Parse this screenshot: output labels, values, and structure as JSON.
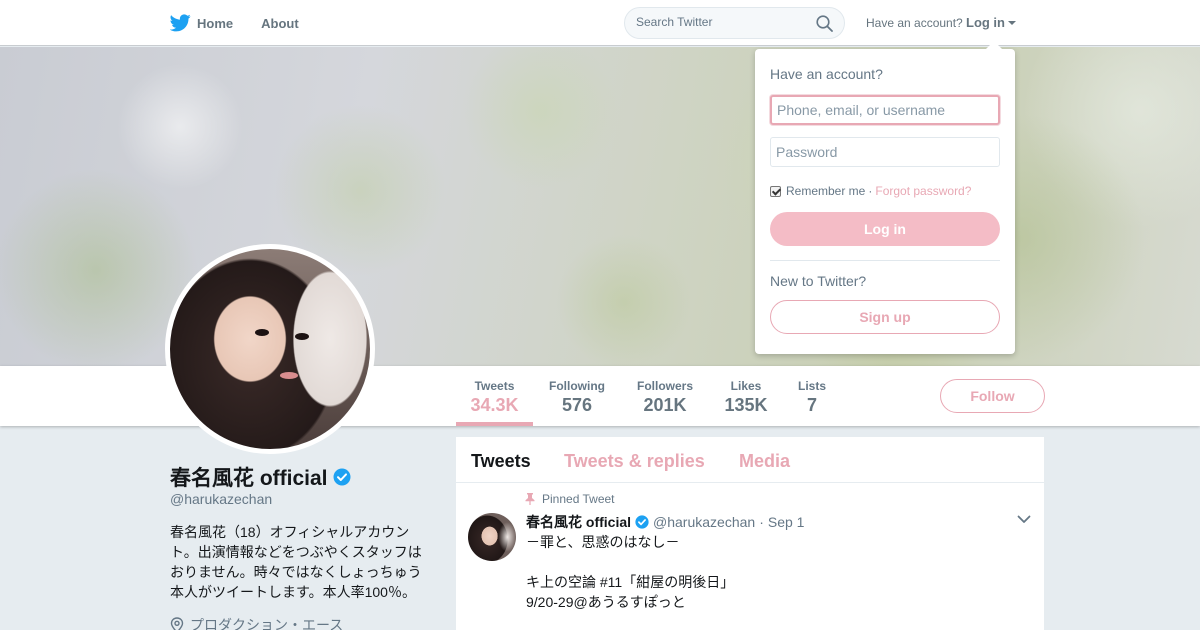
{
  "colors": {
    "accent": "#e8a8b4",
    "twitter_blue": "#1da1f2",
    "verified_blue": "#1da1f2",
    "muted": "#657786"
  },
  "nav": {
    "home_label": "Home",
    "about_label": "About",
    "search_placeholder": "Search Twitter",
    "account_prompt": "Have an account?",
    "login_label": "Log in"
  },
  "login_dropdown": {
    "title": "Have an account?",
    "username_placeholder": "Phone, email, or username",
    "password_placeholder": "Password",
    "remember_me": "Remember me",
    "separator": "·",
    "forgot_password": "Forgot password?",
    "login_button": "Log in",
    "new_prompt": "New to Twitter?",
    "signup_button": "Sign up"
  },
  "stats": [
    {
      "label": "Tweets",
      "value": "34.3K"
    },
    {
      "label": "Following",
      "value": "576"
    },
    {
      "label": "Followers",
      "value": "201K"
    },
    {
      "label": "Likes",
      "value": "135K"
    },
    {
      "label": "Lists",
      "value": "7"
    }
  ],
  "follow_button": "Follow",
  "profile": {
    "name": "春名風花 official",
    "handle": "@harukazechan",
    "bio": "春名風花（18）オフィシャルアカウント。出演情報などをつぶやくスタッフはおりません。時々ではなくしょっちゅう本人がツイートします。本人率100％。",
    "location": "プロダクション・エース"
  },
  "tabs": [
    "Tweets",
    "Tweets & replies",
    "Media"
  ],
  "tweet": {
    "pinned_label": "Pinned Tweet",
    "name": "春名風花 official",
    "handle": "@harukazechan",
    "separator": "·",
    "date": "Sep 1",
    "lines": [
      "－罪と、思惑のはなし－",
      "",
      "キ上の空論  #11「紺屋の明後日」",
      "9/20-29@あうるすぽっと"
    ]
  }
}
